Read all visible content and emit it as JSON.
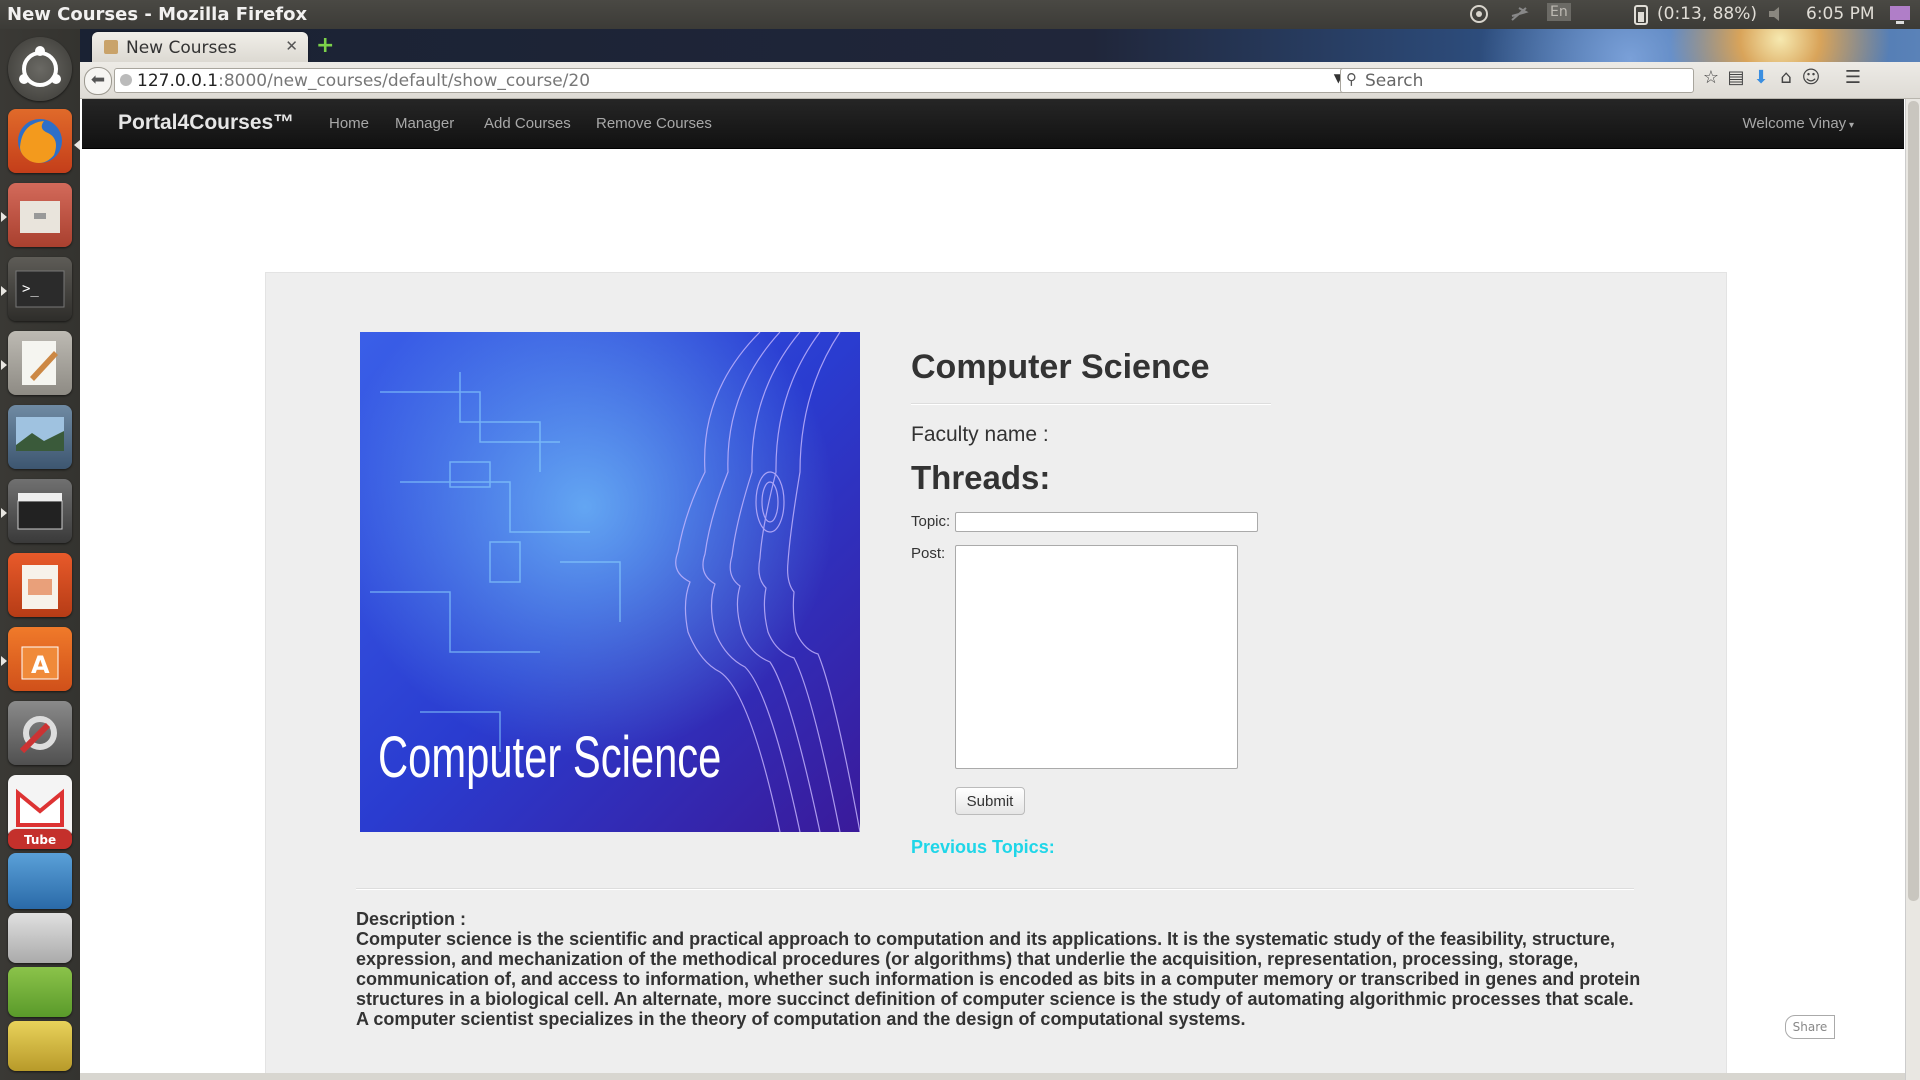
{
  "window": {
    "title": "New Courses - Mozilla Firefox"
  },
  "panel": {
    "battery": "(0:13, 88%)",
    "keyboard": "En",
    "clock": "6:05 PM"
  },
  "browser": {
    "tab_title": "New Courses",
    "url_host": "127.0.0.1",
    "url_path": ":8000/new_courses/default/show_course/20",
    "search_placeholder": "Search"
  },
  "site": {
    "brand": "Portal4Courses™",
    "nav": [
      "Home",
      "Manager",
      "Add Courses",
      "Remove Courses"
    ],
    "user_menu": "Welcome Vinay"
  },
  "course": {
    "image_text": "Computer Science",
    "title": "Computer Science",
    "faculty_label": "Faculty name :",
    "threads_heading": "Threads:",
    "topic_label": "Topic:",
    "post_label": "Post:",
    "topic_value": "",
    "post_value": "",
    "submit_label": "Submit",
    "previous_topics": "Previous Topics:",
    "description_label": "Description :",
    "description": "Computer science is the scientific and practical approach to computation and its applications. It is the systematic study of the feasibility, structure, expression, and mechanization of the methodical procedures (or algorithms) that underlie the acquisition, representation, processing, storage, communication of, and access to information, whether such information is encoded as bits in a computer memory or transcribed in genes and protein structures in a biological cell. An alternate, more succinct definition of computer science is the study of automating algorithmic processes that scale. A computer scientist specializes in the theory of computation and the design of computational systems."
  },
  "share_label": "Share",
  "colors": {
    "accent": "#1fd6e8",
    "navbar": "#1b1b1b",
    "well": "#eeeeee"
  }
}
